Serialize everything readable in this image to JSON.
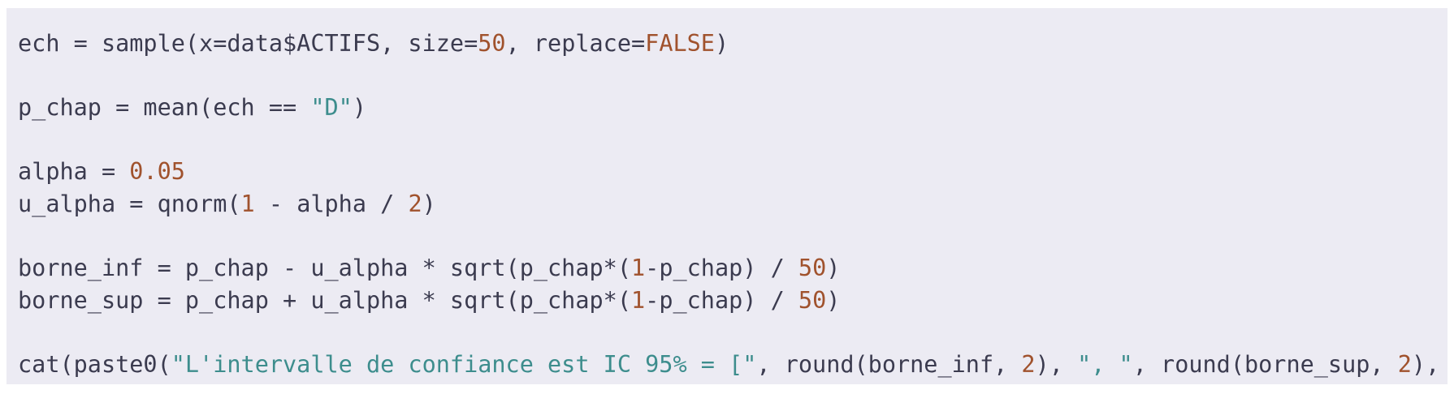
{
  "code": {
    "language": "r",
    "lines": [
      [
        {
          "t": "ech = sample(x=data$ACTIFS, size=",
          "k": "plain"
        },
        {
          "t": "50",
          "k": "num"
        },
        {
          "t": ", replace=",
          "k": "plain"
        },
        {
          "t": "FALSE",
          "k": "bool"
        },
        {
          "t": ")",
          "k": "plain"
        }
      ],
      [],
      [
        {
          "t": "p_chap = mean(ech == ",
          "k": "plain"
        },
        {
          "t": "\"D\"",
          "k": "str"
        },
        {
          "t": ")",
          "k": "plain"
        }
      ],
      [],
      [
        {
          "t": "alpha = ",
          "k": "plain"
        },
        {
          "t": "0.05",
          "k": "num"
        }
      ],
      [
        {
          "t": "u_alpha = qnorm(",
          "k": "plain"
        },
        {
          "t": "1",
          "k": "num"
        },
        {
          "t": " - alpha / ",
          "k": "plain"
        },
        {
          "t": "2",
          "k": "num"
        },
        {
          "t": ")",
          "k": "plain"
        }
      ],
      [],
      [
        {
          "t": "borne_inf = p_chap - u_alpha * sqrt(p_chap*(",
          "k": "plain"
        },
        {
          "t": "1",
          "k": "num"
        },
        {
          "t": "-p_chap) / ",
          "k": "plain"
        },
        {
          "t": "50",
          "k": "num"
        },
        {
          "t": ")",
          "k": "plain"
        }
      ],
      [
        {
          "t": "borne_sup = p_chap + u_alpha * sqrt(p_chap*(",
          "k": "plain"
        },
        {
          "t": "1",
          "k": "num"
        },
        {
          "t": "-p_chap) / ",
          "k": "plain"
        },
        {
          "t": "50",
          "k": "num"
        },
        {
          "t": ")",
          "k": "plain"
        }
      ],
      [],
      [
        {
          "t": "cat(paste0(",
          "k": "plain"
        },
        {
          "t": "\"L'intervalle de confiance est IC 95% = [\"",
          "k": "str"
        },
        {
          "t": ", round(borne_inf, ",
          "k": "plain"
        },
        {
          "t": "2",
          "k": "num"
        },
        {
          "t": "), ",
          "k": "plain"
        },
        {
          "t": "\", \"",
          "k": "str"
        },
        {
          "t": ", round(borne_sup, ",
          "k": "plain"
        },
        {
          "t": "2",
          "k": "num"
        },
        {
          "t": "), ",
          "k": "plain"
        },
        {
          "t": "\"]\"",
          "k": "str"
        },
        {
          "t": "))",
          "k": "plain"
        }
      ]
    ]
  }
}
